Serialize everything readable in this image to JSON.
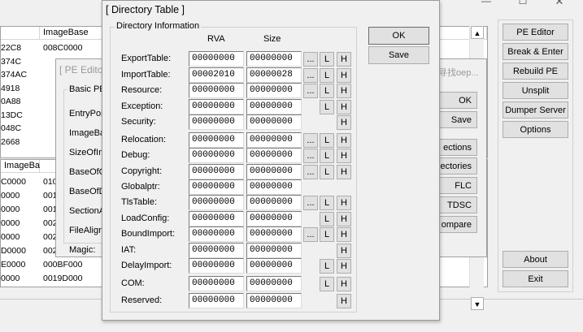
{
  "main_window": {
    "title_controls": {
      "minimize": "—",
      "maximize": "☐",
      "close": "✕"
    },
    "table1": {
      "header": "ImageBase",
      "rows": [
        {
          "a": "22C8",
          "b": "008C0000"
        },
        {
          "a": "374C",
          "b": ""
        },
        {
          "a": "374AC",
          "b": ""
        },
        {
          "a": "4918",
          "b": ""
        },
        {
          "a": "0A88",
          "b": ""
        },
        {
          "a": "13DC",
          "b": ""
        },
        {
          "a": "048C",
          "b": ""
        },
        {
          "a": "2668",
          "b": ""
        }
      ]
    },
    "table2": {
      "header_a": "ImageBase",
      "header_b": "",
      "rows": [
        {
          "a": "C0000",
          "b": "010"
        },
        {
          "a": "0000",
          "b": "001"
        },
        {
          "a": "0000",
          "b": "001"
        },
        {
          "a": "0000",
          "b": "002"
        },
        {
          "a": "0000",
          "b": "002"
        },
        {
          "a": "D0000",
          "b": "002"
        },
        {
          "a": "E0000",
          "b": "000BF000"
        },
        {
          "a": "0000",
          "b": "0019D000"
        }
      ]
    },
    "right_buttons": [
      "PE Editor",
      "Break & Enter",
      "Rebuild PE",
      "Unsplit",
      "Dumper Server",
      "Options"
    ],
    "bottom_buttons": [
      "About",
      "Exit"
    ],
    "scroll_up": "▲",
    "scroll_down": "▼"
  },
  "pe_editor": {
    "title": "[ PE Edito",
    "group_label": "Basic PE",
    "fields": [
      "EntryPoi",
      "ImageBa",
      "SizeOfIm",
      "BaseOfC",
      "BaseOfD",
      "SectionA",
      "FileAlign",
      "Magic:"
    ],
    "chinese_text": "寻找oep...",
    "buttons": [
      "OK",
      "Save",
      "ections",
      "ectories",
      "FLC",
      "TDSC",
      "ompare"
    ]
  },
  "dir_table": {
    "title": "[ Directory Table ]",
    "group_label": "Directory Information",
    "col_rva": "RVA",
    "col_size": "Size",
    "ok": "OK",
    "save": "Save",
    "rows": [
      {
        "name": "ExportTable:",
        "rva": "00000000",
        "size": "00000000",
        "dots": "...",
        "l": "L",
        "h": "H"
      },
      {
        "name": "ImportTable:",
        "rva": "00002010",
        "size": "00000028",
        "dots": "...",
        "l": "L",
        "h": "H"
      },
      {
        "name": "Resource:",
        "rva": "00000000",
        "size": "00000000",
        "dots": "...",
        "l": "L",
        "h": "H"
      },
      {
        "name": "Exception:",
        "rva": "00000000",
        "size": "00000000",
        "dots": "",
        "l": "L",
        "h": "H"
      },
      {
        "name": "Security:",
        "rva": "00000000",
        "size": "00000000",
        "dots": "",
        "l": "",
        "h": "H"
      },
      {
        "name": "Relocation:",
        "rva": "00000000",
        "size": "00000000",
        "dots": "...",
        "l": "L",
        "h": "H"
      },
      {
        "name": "Debug:",
        "rva": "00000000",
        "size": "00000000",
        "dots": "...",
        "l": "L",
        "h": "H"
      },
      {
        "name": "Copyright:",
        "rva": "00000000",
        "size": "00000000",
        "dots": "...",
        "l": "L",
        "h": "H"
      },
      {
        "name": "Globalptr:",
        "rva": "00000000",
        "size": "00000000",
        "dots": "",
        "l": "",
        "h": ""
      },
      {
        "name": "TlsTable:",
        "rva": "00000000",
        "size": "00000000",
        "dots": "...",
        "l": "L",
        "h": "H"
      },
      {
        "name": "LoadConfig:",
        "rva": "00000000",
        "size": "00000000",
        "dots": "",
        "l": "L",
        "h": "H"
      },
      {
        "name": "BoundImport:",
        "rva": "00000000",
        "size": "00000000",
        "dots": "...",
        "l": "L",
        "h": "H"
      },
      {
        "name": "IAT:",
        "rva": "00000000",
        "size": "00000000",
        "dots": "",
        "l": "",
        "h": "H"
      },
      {
        "name": "DelayImport:",
        "rva": "00000000",
        "size": "00000000",
        "dots": "",
        "l": "L",
        "h": "H"
      },
      {
        "name": "COM:",
        "rva": "00000000",
        "size": "00000000",
        "dots": "",
        "l": "L",
        "h": "H"
      },
      {
        "name": "Reserved:",
        "rva": "00000000",
        "size": "00000000",
        "dots": "",
        "l": "",
        "h": "H"
      }
    ]
  }
}
